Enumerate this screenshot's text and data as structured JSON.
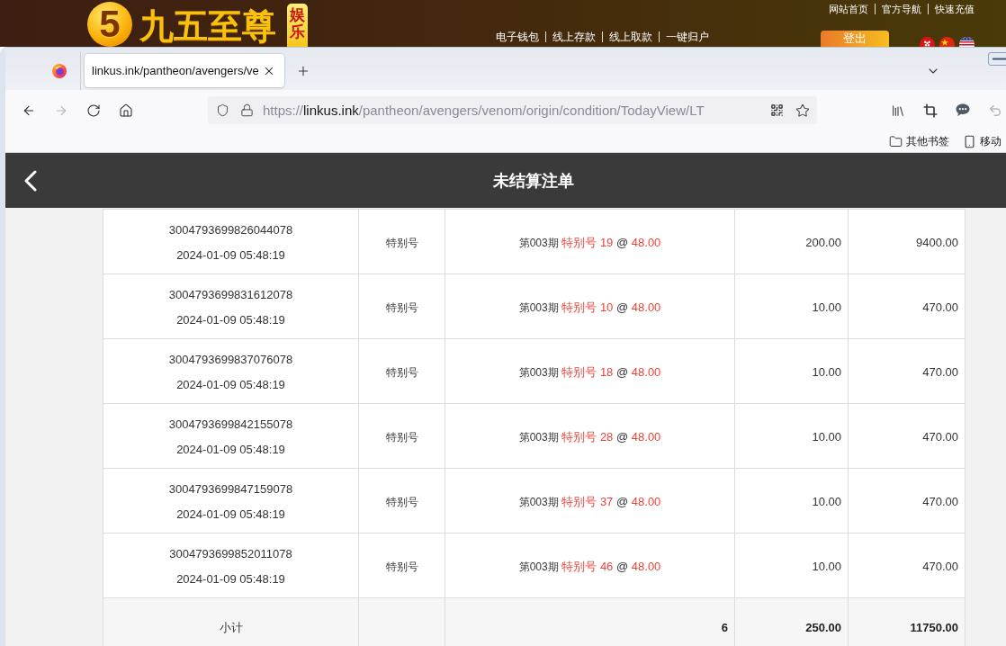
{
  "site_banner": {
    "logo_mark": "5",
    "site_name": "九五至尊",
    "tagline": "娱乐",
    "top_links": [
      "网站首页",
      "官方导航",
      "快速充值"
    ],
    "account_links": [
      "电子钱包",
      "线上存款",
      "线上取款",
      "一键归户"
    ],
    "logout_button": "登出"
  },
  "browser": {
    "tab": {
      "title": "linkus.ink/pantheon/avengers/ve"
    },
    "navigation": {
      "forward_disabled": true
    },
    "address": {
      "scheme": "https://",
      "host": "linkus.ink",
      "path": "/pantheon/avengers/venom/origin/condition/TodayView/LT"
    },
    "toolbar": {
      "undo_disabled": true
    },
    "bookmarks": [
      {
        "kind": "folder",
        "label": "其他书签"
      },
      {
        "kind": "mobile",
        "label": "移动"
      }
    ]
  },
  "page": {
    "title": "未结算注单",
    "bets": [
      {
        "id": "3004793699826044078",
        "time": "2024-01-09 05:48:19",
        "type": "特别号",
        "period": "第003期",
        "selection": "特别号 19",
        "at": "@",
        "odds": "48.00",
        "stake": "200.00",
        "payout": "9400.00"
      },
      {
        "id": "3004793699831612078",
        "time": "2024-01-09 05:48:19",
        "type": "特别号",
        "period": "第003期",
        "selection": "特别号 10",
        "at": "@",
        "odds": "48.00",
        "stake": "10.00",
        "payout": "470.00"
      },
      {
        "id": "3004793699837076078",
        "time": "2024-01-09 05:48:19",
        "type": "特别号",
        "period": "第003期",
        "selection": "特别号 18",
        "at": "@",
        "odds": "48.00",
        "stake": "10.00",
        "payout": "470.00"
      },
      {
        "id": "3004793699842155078",
        "time": "2024-01-09 05:48:19",
        "type": "特别号",
        "period": "第003期",
        "selection": "特别号 28",
        "at": "@",
        "odds": "48.00",
        "stake": "10.00",
        "payout": "470.00"
      },
      {
        "id": "3004793699847159078",
        "time": "2024-01-09 05:48:19",
        "type": "特别号",
        "period": "第003期",
        "selection": "特别号 37",
        "at": "@",
        "odds": "48.00",
        "stake": "10.00",
        "payout": "470.00"
      },
      {
        "id": "3004793699852011078",
        "time": "2024-01-09 05:48:19",
        "type": "特别号",
        "period": "第003期",
        "selection": "特别号 46",
        "at": "@",
        "odds": "48.00",
        "stake": "10.00",
        "payout": "470.00"
      }
    ],
    "subtotal": {
      "label": "小计",
      "count": "6",
      "stake": "250.00",
      "payout": "11750.00"
    }
  }
}
